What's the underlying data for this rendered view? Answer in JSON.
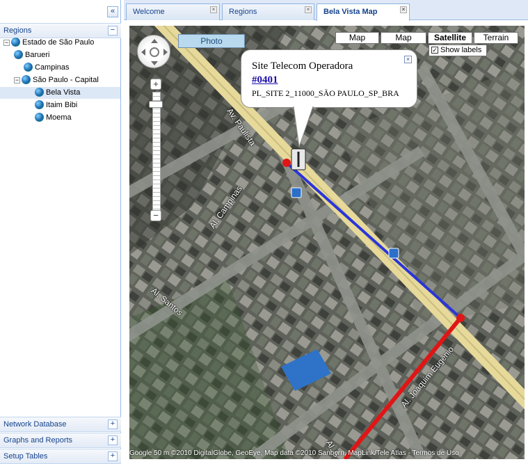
{
  "left_panel": {
    "collapse_symbol": "«",
    "regions_header": "Regions",
    "regions_tool": "−",
    "tree": [
      {
        "label": "Estado de São Paulo",
        "expander": "−"
      },
      {
        "label": "Barueri"
      },
      {
        "label": "Campinas"
      },
      {
        "label": "São Paulo - Capital",
        "expander": "−"
      },
      {
        "label": "Bela Vista",
        "selected": true
      },
      {
        "label": "Itaim Bibi"
      },
      {
        "label": "Moema"
      }
    ],
    "sections": [
      {
        "label": "Network Database",
        "tool": "+"
      },
      {
        "label": "Graphs and Reports",
        "tool": "+"
      },
      {
        "label": "Setup Tables",
        "tool": "+"
      }
    ]
  },
  "tabs": [
    {
      "label": "Welcome",
      "close": "×"
    },
    {
      "label": "Regions",
      "close": "×"
    },
    {
      "label": "Bela Vista Map",
      "close": "×",
      "active": true
    }
  ],
  "map": {
    "photo_button": "Photo",
    "type_buttons": [
      "Map",
      "Map",
      "Satellite",
      "Terrain"
    ],
    "active_type": "Satellite",
    "show_labels": "Show labels",
    "show_labels_checked": "✓",
    "zoom_in": "+",
    "zoom_out": "−",
    "info_window": {
      "title": "Site Telecom Operadora",
      "link": "#0401",
      "description": "PL_SITE 2_11000_SÃO PAULO_SP_BRA",
      "close": "×"
    },
    "streets": [
      "Av. Paulista",
      "Al. Campinas",
      "Al. Santos",
      "Al. Joaquim Eugênio",
      "Al. S"
    ],
    "footer": "Google   50 m   ©2010 DigitalGlobe, GeoEye, Map data ©2010 Sanborn, MapLink/Tele Atlas - Termos de Uso",
    "colors": {
      "route_blue": "#2a35d8",
      "route_red": "#e01515",
      "avenue": "#e6d99a"
    }
  }
}
